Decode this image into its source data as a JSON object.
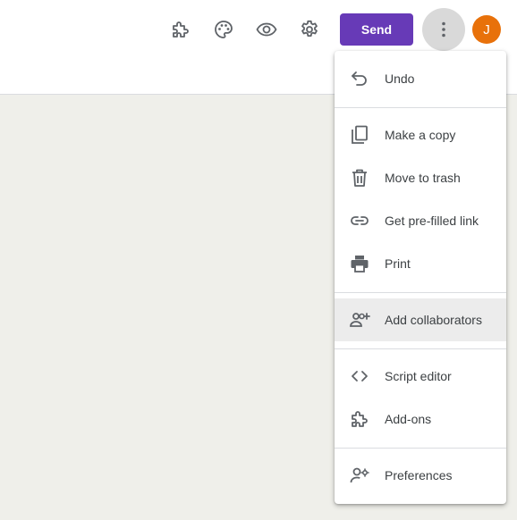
{
  "toolbar": {
    "send_label": "Send",
    "avatar_initial": "J",
    "icons": [
      "addon-icon",
      "palette-icon",
      "eye-icon",
      "gear-icon",
      "more-vert-icon"
    ]
  },
  "menu": {
    "undo": "Undo",
    "make_copy": "Make a copy",
    "move_to_trash": "Move to trash",
    "prefilled_link": "Get pre-filled link",
    "print": "Print",
    "add_collaborators": "Add collaborators",
    "script_editor": "Script editor",
    "addons": "Add-ons",
    "preferences": "Preferences"
  },
  "colors": {
    "send_button": "#673ab7",
    "avatar": "#e8710a",
    "page_background": "#efefea",
    "highlighted_item": "#ececec"
  }
}
